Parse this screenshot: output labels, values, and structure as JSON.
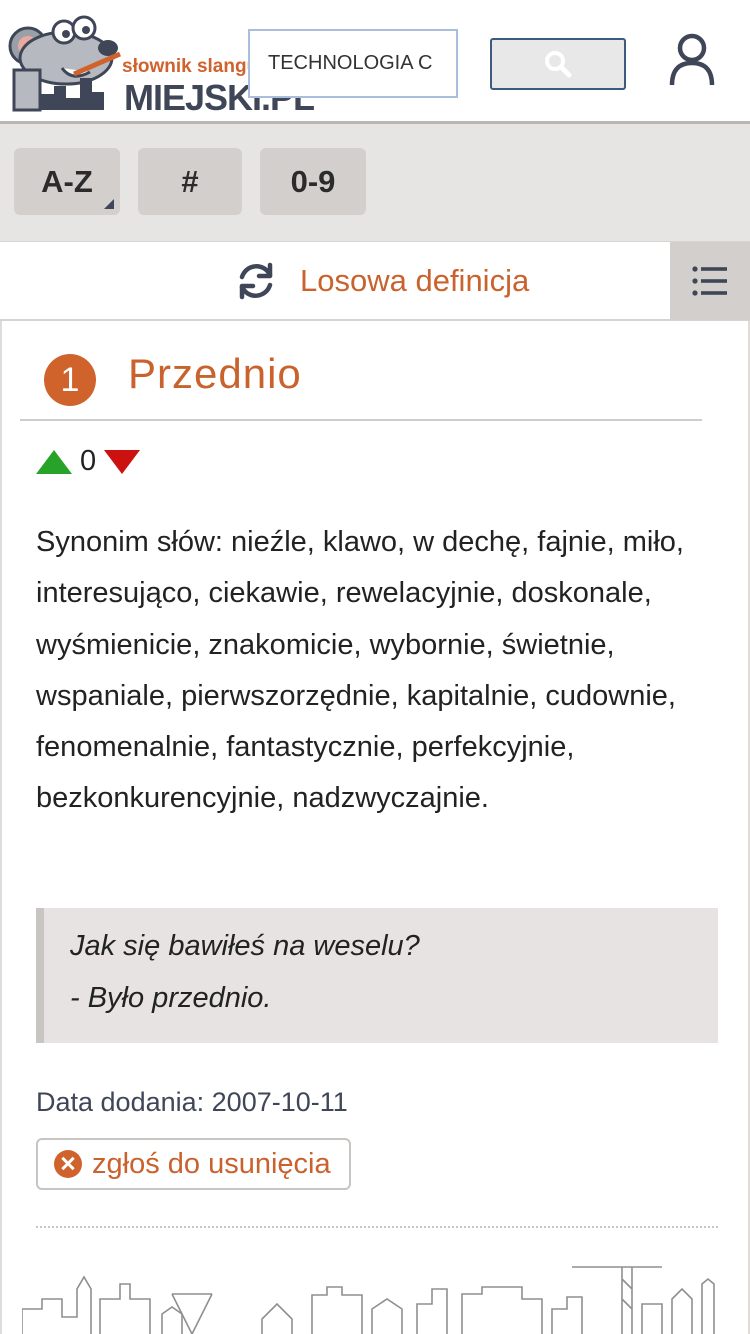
{
  "header": {
    "logo": {
      "top_text": "słownik slangu",
      "main_text": "MIEJSKI.PL"
    },
    "search": {
      "value": "TECHNOLOGIA C",
      "placeholder": ""
    },
    "search_icon": "search-icon",
    "user_icon": "user-icon"
  },
  "letters": [
    {
      "label": "A-Z",
      "has_dropdown": true
    },
    {
      "label": "#"
    },
    {
      "label": "0-9"
    }
  ],
  "random": {
    "label": "Losowa definicja",
    "icon": "refresh-icon",
    "menu_icon": "list-icon"
  },
  "entry": {
    "number": "1",
    "title": "Przednio",
    "votes": "0",
    "definition": "Synonim słów: nieźle, klawo, w dechę, fajnie, miło, interesująco, ciekawie, rewelacyjnie, doskonale, wyśmienicie, znakomicie, wybornie, świetnie, wspaniale, pierwszorzędnie, kapitalnie, cudownie, fenomenalnie, fantastycznie, perfekcyjnie, bezkonkurencyjnie, nadzwyczajnie.",
    "example_lines": [
      "Jak się bawiłeś na weselu?",
      "- Było przednio."
    ],
    "date_label": "Data dodania:",
    "date_value": "2007-10-11",
    "report_label": "zgłoś do usunięcia"
  },
  "colors": {
    "accent": "#c9622c",
    "up": "#27a329",
    "down": "#cc1111",
    "navy": "#3e4657"
  }
}
